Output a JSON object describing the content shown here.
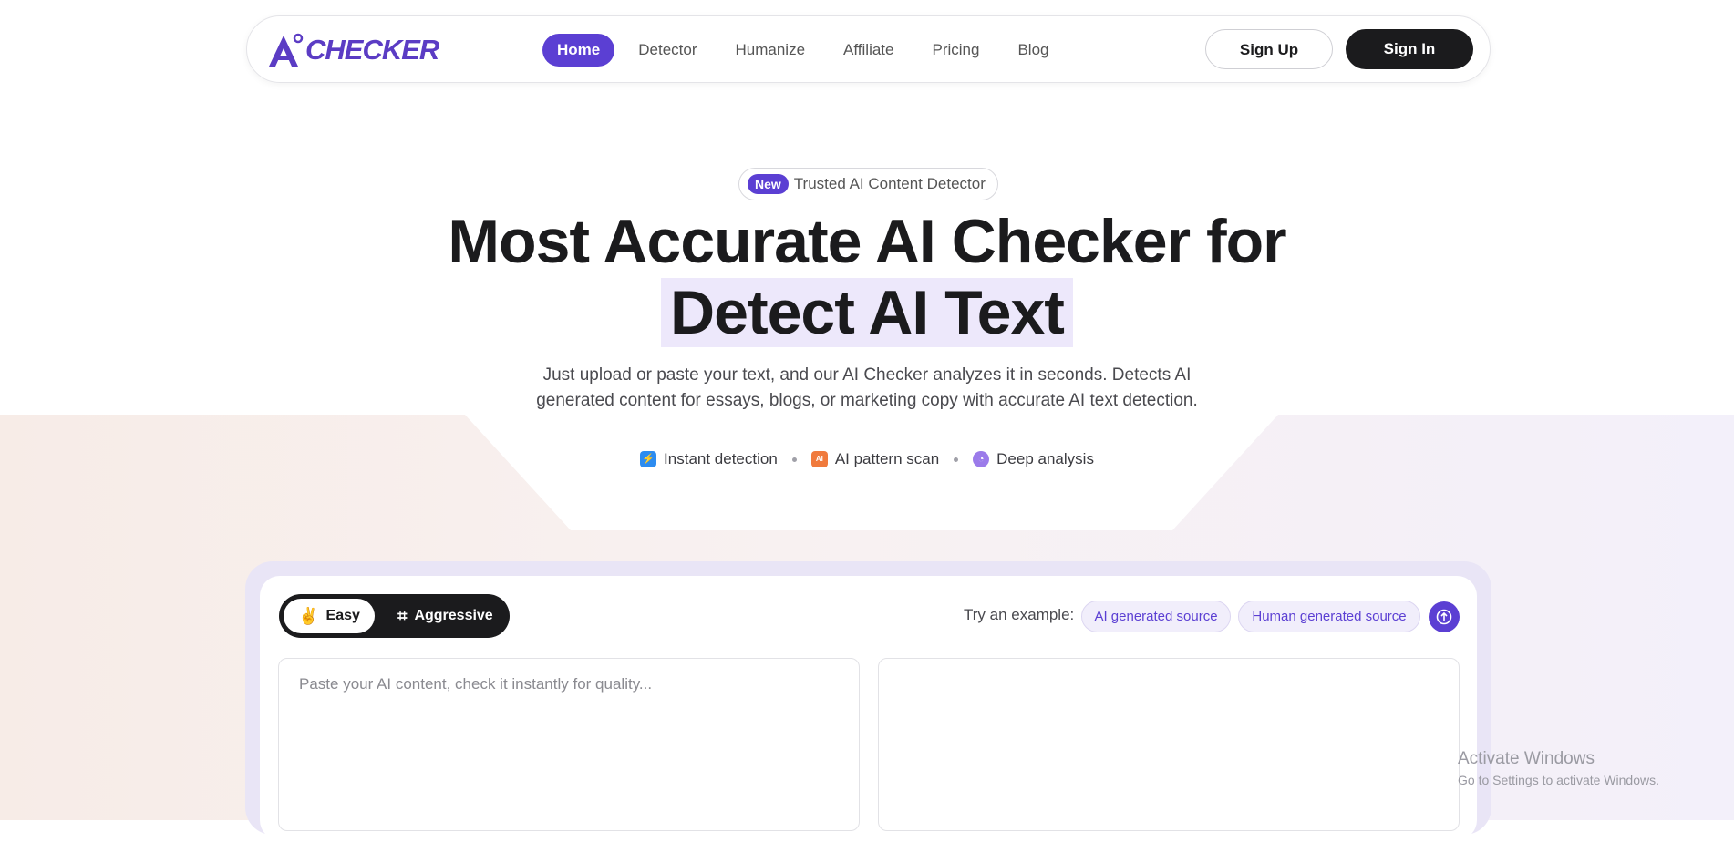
{
  "nav": {
    "logo_text": "CHECKER",
    "logo_icon": "ai-checker-logo-icon",
    "links": [
      "Home",
      "Detector",
      "Humanize",
      "Affiliate",
      "Pricing",
      "Blog"
    ],
    "active_link": "Home",
    "signup_label": "Sign Up",
    "signin_label": "Sign In"
  },
  "hero": {
    "badge_new": "New",
    "badge_text": "Trusted AI Content Detector",
    "title_line1": "Most Accurate AI Checker for",
    "title_line2": "Detect AI Text",
    "subtitle": "Just upload or paste your text, and our AI Checker analyzes it in seconds. Detects AI generated content for essays, blogs, or marketing copy with accurate AI text detection.",
    "features": [
      {
        "label": "Instant detection",
        "icon": "lightning-icon",
        "color": "#2d8cf0",
        "glyph": "⚡"
      },
      {
        "label": "AI pattern scan",
        "icon": "ai-scan-icon",
        "color": "#f07a3c",
        "glyph": "AI"
      },
      {
        "label": "Deep analysis",
        "icon": "analysis-icon",
        "color": "#9b7bea",
        "glyph": "◔"
      }
    ]
  },
  "detector": {
    "modes": {
      "easy": "Easy",
      "aggressive": "Aggressive"
    },
    "try_label": "Try an example:",
    "examples": {
      "ai": "AI generated source",
      "human": "Human generated source"
    },
    "input_placeholder": "Paste your AI content, check it instantly for quality..."
  },
  "watermark": {
    "line1": "Activate Windows",
    "line2": "Go to Settings to activate Windows."
  },
  "colors": {
    "accent": "#5b3fd3",
    "dark": "#1b1b1d"
  }
}
